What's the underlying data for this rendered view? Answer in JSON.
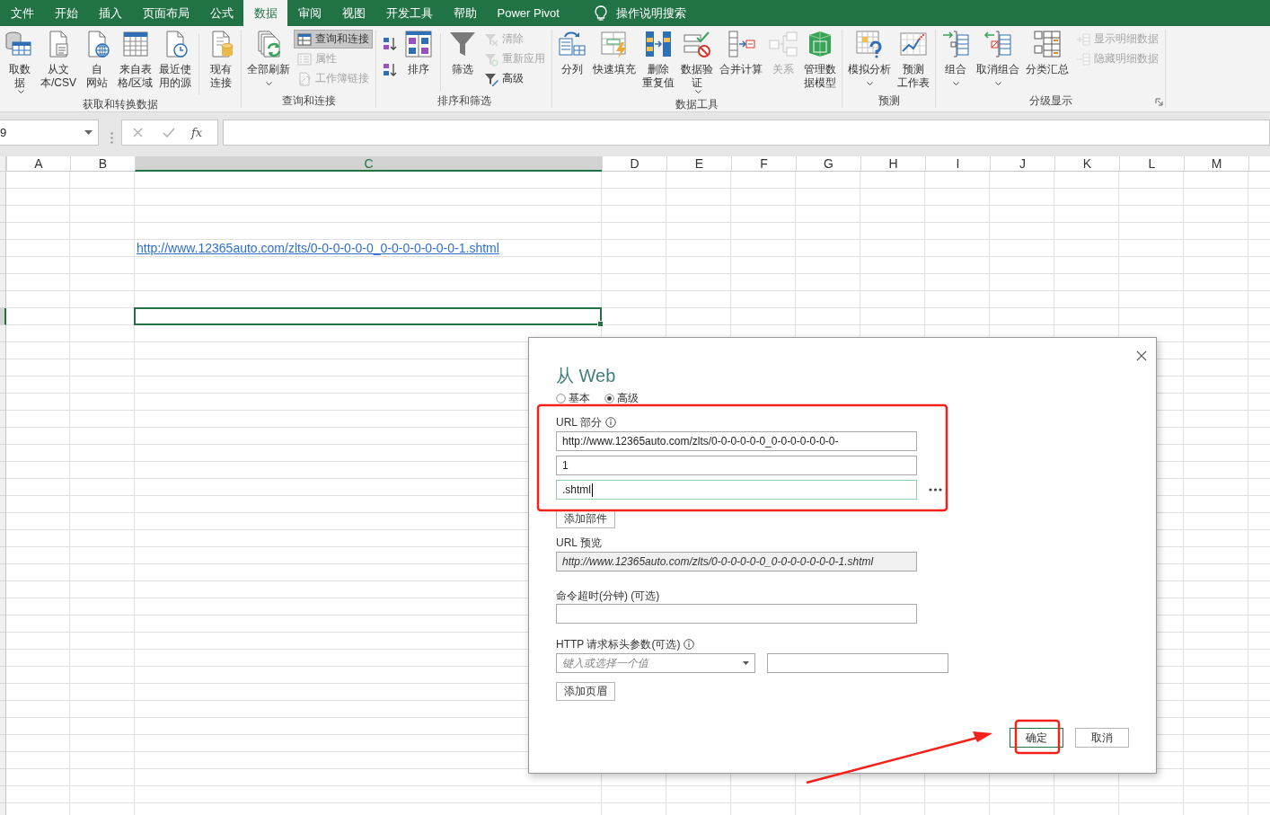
{
  "tabs": [
    {
      "label": "文件",
      "selected": false
    },
    {
      "label": "开始",
      "selected": false
    },
    {
      "label": "插入",
      "selected": false
    },
    {
      "label": "页面布局",
      "selected": false
    },
    {
      "label": "公式",
      "selected": false
    },
    {
      "label": "数据",
      "selected": true
    },
    {
      "label": "审阅",
      "selected": false
    },
    {
      "label": "视图",
      "selected": false
    },
    {
      "label": "开发工具",
      "selected": false
    },
    {
      "label": "帮助",
      "selected": false
    },
    {
      "label": "Power Pivot",
      "selected": false
    }
  ],
  "search": {
    "placeholder": "操作说明搜索"
  },
  "ribbon": {
    "groups": [
      {
        "label": "获取和转换数据",
        "items": [
          {
            "kind": "large",
            "label": "取数据",
            "dropdown": true,
            "disabled": false
          },
          {
            "kind": "large",
            "label": "从文本/CSV",
            "disabled": false
          },
          {
            "kind": "large",
            "label": "自网站",
            "disabled": false
          },
          {
            "kind": "large",
            "label": "来自表格/区域",
            "disabled": false
          },
          {
            "kind": "large",
            "label": "最近使用的源",
            "disabled": false
          },
          {
            "kind": "separator"
          },
          {
            "kind": "large",
            "label": "现有连接",
            "disabled": false
          }
        ]
      },
      {
        "label": "查询和连接",
        "items": [
          {
            "kind": "large",
            "label": "全部刷新",
            "dropdown": true,
            "disabled": false
          },
          {
            "kind": "stack",
            "items": [
              {
                "label": "查询和连接",
                "pressed": true,
                "disabled": false
              },
              {
                "label": "属性",
                "pressed": false,
                "disabled": true
              },
              {
                "label": "工作簿链接",
                "pressed": false,
                "disabled": true
              }
            ]
          }
        ]
      },
      {
        "label": "排序和筛选",
        "items": [
          {
            "kind": "stack",
            "items": [
              {
                "pressed": false,
                "disabled": false
              },
              {
                "pressed": false,
                "disabled": false
              }
            ]
          },
          {
            "kind": "large",
            "label": "排序",
            "disabled": false
          },
          {
            "kind": "separator"
          },
          {
            "kind": "large",
            "label": "筛选",
            "disabled": false
          },
          {
            "kind": "stack",
            "items": [
              {
                "label": "清除",
                "pressed": false,
                "disabled": true
              },
              {
                "label": "重新应用",
                "pressed": false,
                "disabled": true
              },
              {
                "label": "高级",
                "pressed": false,
                "disabled": false
              }
            ]
          }
        ]
      },
      {
        "label": "数据工具",
        "items": [
          {
            "kind": "large",
            "label": "分列",
            "disabled": false
          },
          {
            "kind": "large",
            "label": "快速填充",
            "disabled": false
          },
          {
            "kind": "large",
            "label": "删除重复值",
            "disabled": false
          },
          {
            "kind": "large",
            "label": "数据验证",
            "dropdown": true,
            "disabled": false
          },
          {
            "kind": "large",
            "label": "合并计算",
            "disabled": false
          },
          {
            "kind": "large",
            "label": "关系",
            "disabled": true
          },
          {
            "kind": "large",
            "label": "管理数据模型",
            "disabled": false
          }
        ]
      },
      {
        "label": "预测",
        "items": [
          {
            "kind": "large",
            "label": "模拟分析",
            "dropdown": true,
            "disabled": false
          },
          {
            "kind": "large",
            "label": "预测工作表",
            "disabled": false
          }
        ]
      },
      {
        "label": "分级显示",
        "dialog_launcher": true,
        "items": [
          {
            "kind": "large",
            "label": "组合",
            "dropdown": true,
            "disabled": false
          },
          {
            "kind": "large",
            "label": "取消组合",
            "dropdown": true,
            "disabled": false
          },
          {
            "kind": "large",
            "label": "分类汇总",
            "disabled": false
          },
          {
            "kind": "stack",
            "items": [
              {
                "label": "显示明细数据",
                "pressed": false,
                "disabled": true
              },
              {
                "label": "隐藏明细数据",
                "pressed": false,
                "disabled": true
              }
            ]
          }
        ]
      }
    ]
  },
  "formula_bar": {
    "name_box": "9",
    "function_label": "fx"
  },
  "sheet": {
    "columns": [
      {
        "label": "A",
        "selected": false
      },
      {
        "label": "B",
        "selected": false
      },
      {
        "label": "C",
        "selected": true
      },
      {
        "label": "D",
        "selected": false
      },
      {
        "label": "E",
        "selected": false
      },
      {
        "label": "F",
        "selected": false
      },
      {
        "label": "G",
        "selected": false
      },
      {
        "label": "H",
        "selected": false
      },
      {
        "label": "I",
        "selected": false
      },
      {
        "label": "J",
        "selected": false
      },
      {
        "label": "K",
        "selected": false
      },
      {
        "label": "L",
        "selected": false
      },
      {
        "label": "M",
        "selected": false
      }
    ],
    "rows": [
      {
        "selected": false
      },
      {
        "selected": false
      },
      {
        "selected": false
      },
      {
        "selected": false
      },
      {
        "selected": false,
        "link": "http://www.12365auto.com/zlts/0-0-0-0-0-0_0-0-0-0-0-0-0-1.shtml"
      },
      {
        "selected": false
      },
      {
        "selected": false
      },
      {
        "selected": false
      },
      {
        "selected": true
      },
      {
        "selected": false
      },
      {
        "selected": false
      },
      {
        "selected": false
      },
      {
        "selected": false
      },
      {
        "selected": false
      },
      {
        "selected": false
      },
      {
        "selected": false
      },
      {
        "selected": false
      },
      {
        "selected": false
      },
      {
        "selected": false
      },
      {
        "selected": false
      },
      {
        "selected": false
      },
      {
        "selected": false
      },
      {
        "selected": false
      },
      {
        "selected": false
      },
      {
        "selected": false
      },
      {
        "selected": false
      },
      {
        "selected": false
      },
      {
        "selected": false
      },
      {
        "selected": false
      },
      {
        "selected": false
      },
      {
        "selected": false
      },
      {
        "selected": false
      },
      {
        "selected": false
      },
      {
        "selected": false
      },
      {
        "selected": false
      },
      {
        "selected": false
      },
      {
        "selected": false
      },
      {
        "selected": false
      }
    ]
  },
  "dialog": {
    "title": "从 Web",
    "modes": [
      {
        "label": "基本",
        "selected": false
      },
      {
        "label": "高级",
        "selected": true
      }
    ],
    "url_parts_label": "URL 部分",
    "url_parts": [
      {
        "value": "http://www.12365auto.com/zlts/0-0-0-0-0-0_0-0-0-0-0-0-0-",
        "focused": false
      },
      {
        "value": "1",
        "focused": false
      },
      {
        "value": ".shtml",
        "focused": true
      }
    ],
    "add_part_button": "添加部件",
    "preview_label": "URL 预览",
    "preview": "http://www.12365auto.com/zlts/0-0-0-0-0-0_0-0-0-0-0-0-0-1.shtml",
    "timeout_label": "命令超时(分钟) (可选)",
    "headers_label": "HTTP 请求标头参数(可选)",
    "header_name": {
      "placeholder": "键入或选择一个值"
    },
    "add_header_button": "添加页眉",
    "ok_button": "确定",
    "cancel_button": "取消"
  },
  "annotations": [
    {
      "kind": "frame"
    },
    {
      "kind": "frame"
    },
    {
      "kind": "arrow"
    }
  ]
}
